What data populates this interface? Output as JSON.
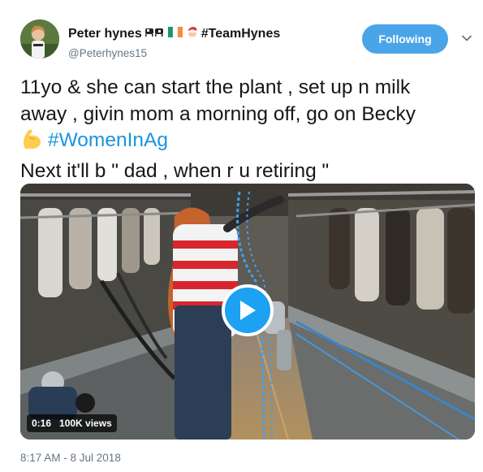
{
  "author": {
    "name": "Peter hynes",
    "name_suffix": "#TeamHynes",
    "handle": "@Peterhynes15",
    "emojis": [
      "cow-icon",
      "ireland-flag-icon",
      "santa-icon"
    ]
  },
  "follow_button": {
    "label": "Following"
  },
  "tweet": {
    "line1": "11yo & she can start the plant , set up n milk",
    "line2": "away , givin mom a morning off, go on Becky",
    "hashtag": "#WomenInAg",
    "line4": "Next it'll b \" dad , when r u retiring \"",
    "emoji": "flexed-biceps-icon"
  },
  "video": {
    "duration": "0:16",
    "views": "100K views"
  },
  "timestamp": "8:17 AM - 8 Jul 2018",
  "colors": {
    "accent": "#1da1f2",
    "follow_button": "#4aa4e8",
    "hashtag": "#1b95e0",
    "secondary_text": "#657786"
  }
}
